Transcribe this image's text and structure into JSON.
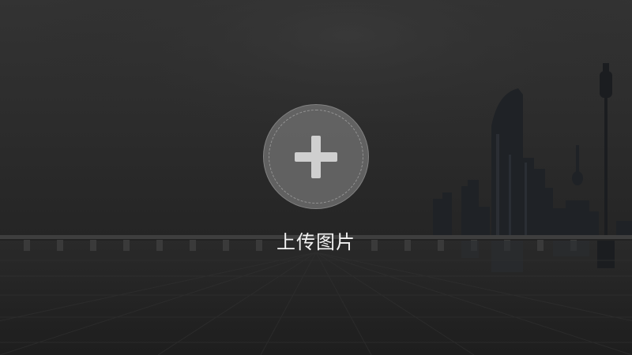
{
  "upload": {
    "label": "上传图片",
    "icon": "plus-icon"
  },
  "colors": {
    "overlay": "#2a2a2a",
    "circle_fill": "#6e6e6e",
    "plus": "#cfcfcf",
    "label": "#f2f2f2"
  }
}
